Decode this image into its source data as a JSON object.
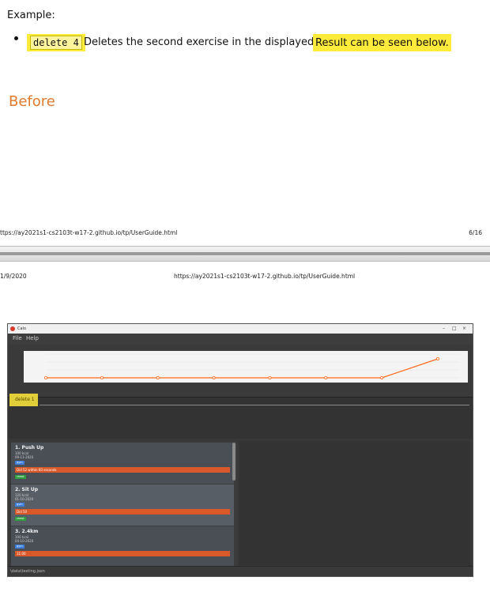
{
  "doc": {
    "example_label": "Example:",
    "command_code": "delete 4",
    "bullet_text": "Deletes the second exercise in the displayed list.",
    "highlight_text": "Result can be seen below.",
    "before_heading": "Before",
    "footer_url": "ttps://ay2021s1-cs2103t-w17-2.github.io/tp/UserGuide.html",
    "footer_page": "6/16",
    "header_date": "1/9/2020",
    "header_url": "https://ay2021s1-cs2103t-w17-2.github.io/tp/UserGuide.html",
    "highlight_color": "#ffeb3b",
    "heading_color": "#e07a2e"
  },
  "app": {
    "title": "Calo",
    "controls": [
      "–",
      "□",
      "×"
    ],
    "menu": [
      "File",
      "Help"
    ],
    "command_box": "delete 1",
    "chart_data": {
      "type": "line",
      "values": [
        0,
        0,
        0,
        0,
        0,
        0,
        0,
        5
      ],
      "color": "#ff6a1a"
    },
    "exercises": [
      {
        "title": "1. Push Up",
        "calories": "100 kcal",
        "date": "09-11-2020",
        "tag": "gym",
        "note": "Did 52 within 60 seconds",
        "label": "chest"
      },
      {
        "title": "2. Sit Up",
        "calories": "120 kcal",
        "date": "01-10-2020",
        "tag": "gym",
        "note": "Did 50",
        "label": "chest"
      },
      {
        "title": "3. 2.4km",
        "calories": "100 kcal",
        "date": "04-10-2020",
        "tag": "gym",
        "note": "11:00"
      }
    ],
    "status": "\\data\\testing.json"
  }
}
